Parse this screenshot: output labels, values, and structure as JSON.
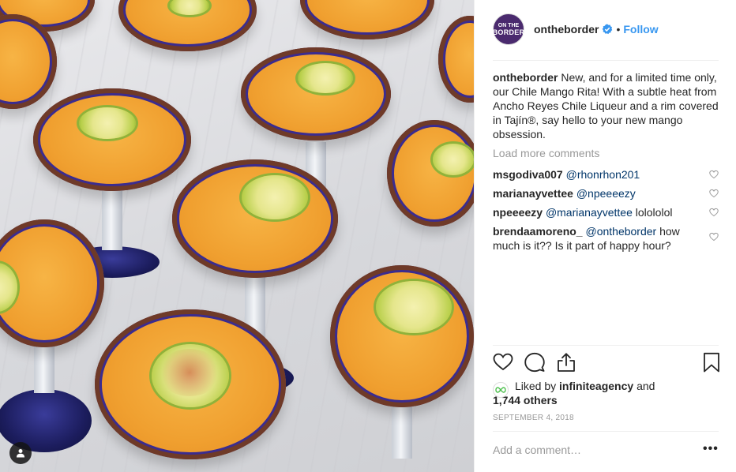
{
  "post": {
    "username": "ontheborder",
    "follow_label": "Follow",
    "separator": "•",
    "avatar_text_top": "ON THE",
    "avatar_text_bottom": "BORDER",
    "caption_user": "ontheborder",
    "caption_text": " New, and for a limited time only, our Chile Mango Rita! With a subtle heat from Ancho Reyes Chile Liqueur and a rim covered in Tajín®, say hello to your new mango obsession.",
    "load_more": "Load more comments"
  },
  "comments": [
    {
      "user": "msgodiva007",
      "mention": "@rhonrhon201",
      "text": ""
    },
    {
      "user": "marianayvettee",
      "mention": "@npeeeezy",
      "text": ""
    },
    {
      "user": "npeeeezy",
      "mention": "@marianayvettee",
      "text": " lolololol"
    },
    {
      "user": "brendaamoreno_",
      "mention": "@ontheborder",
      "text": " how much is it?? Is it part of happy hour?"
    }
  ],
  "likes": {
    "prefix": "Liked by ",
    "liked_by": "infiniteagency",
    "joiner": " and",
    "others": "1,744 others"
  },
  "date": "SEPTEMBER 4, 2018",
  "add_comment_placeholder": "Add a comment…",
  "more_label": "•••",
  "icons": [
    "verified-icon",
    "heart-icon",
    "comment-icon",
    "share-icon",
    "bookmark-icon",
    "user-tag-icon",
    "options-icon"
  ],
  "colors": {
    "link": "#3897f0",
    "mention": "#003569",
    "muted": "#999999",
    "avatar_bg": "#4a2a6e"
  }
}
